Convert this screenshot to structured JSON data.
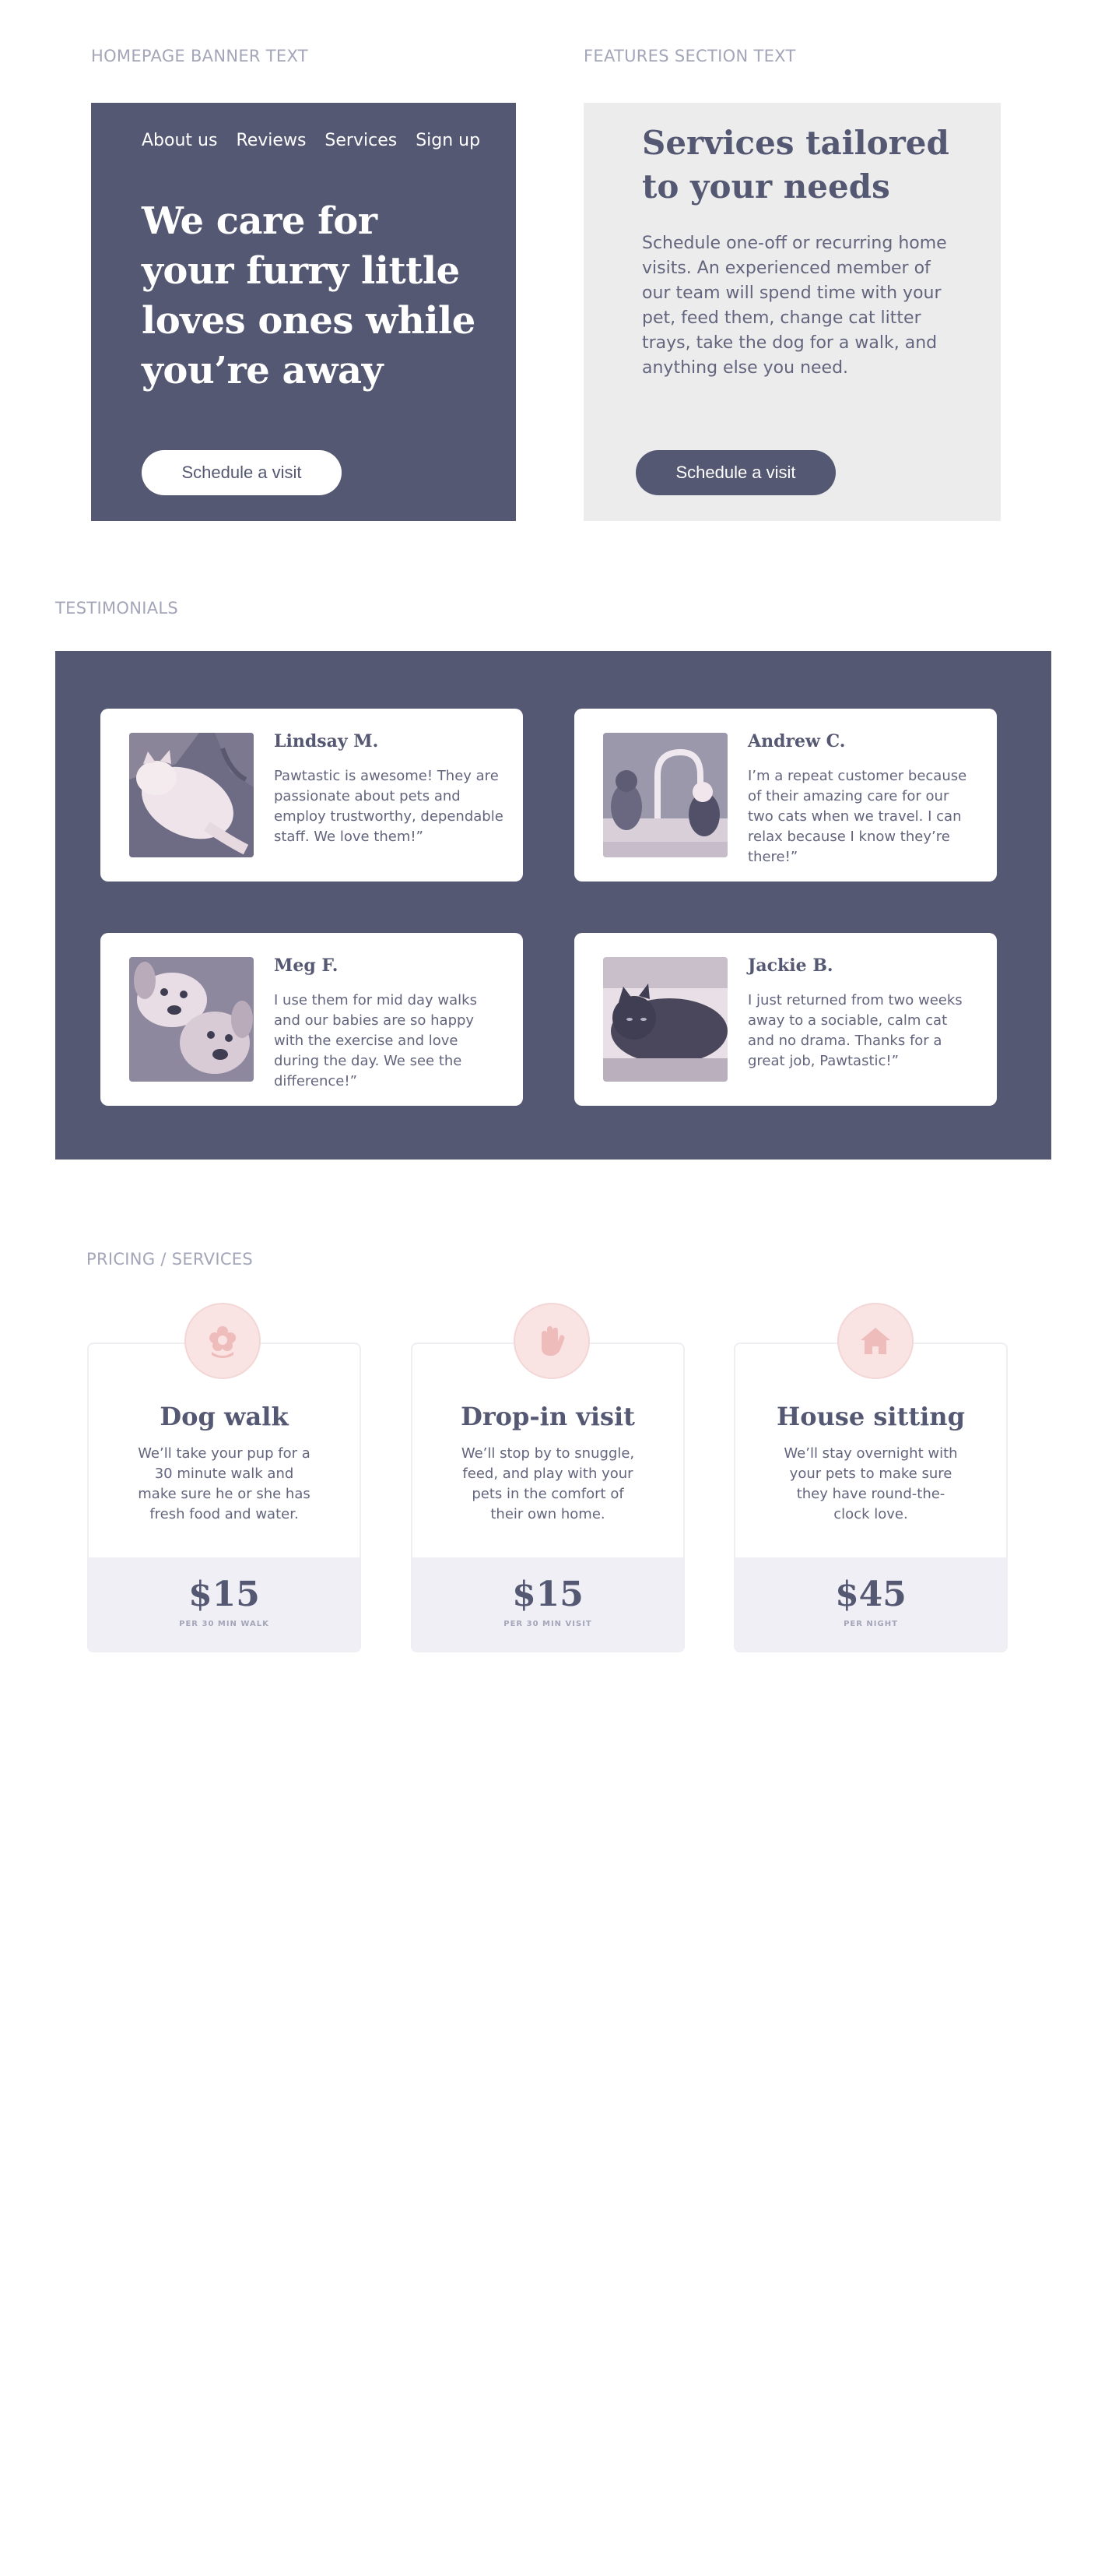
{
  "labels": {
    "banner": "HOMEPAGE BANNER TEXT",
    "features": "FEATURES SECTION TEXT",
    "testimonials": "TESTIMONIALS",
    "pricing": "PRICING / SERVICES"
  },
  "banner": {
    "nav": [
      "About us",
      "Reviews",
      "Services",
      "Sign up"
    ],
    "headline": "We care for your furry little loves ones while you’re away",
    "cta": "Schedule a visit"
  },
  "features": {
    "title": "Services tailored to your needs",
    "body": "Schedule one-off or recurring home visits. An experienced member of our team will spend time with your pet, feed them, change cat litter trays, take the dog for a walk, and anything else you need.",
    "cta": "Schedule a visit"
  },
  "testimonials": [
    {
      "name": "Lindsay M.",
      "text": "Pawtastic is awesome! They are passionate about pets and employ trustworthy, dependable staff. We love them!”",
      "photo": "sleeping-cat-photo"
    },
    {
      "name": "Andrew C.",
      "text": "I’m a repeat customer because of their amazing care for our two cats when we travel. I can relax because I know they’re there!”",
      "photo": "cats-at-faucet-photo"
    },
    {
      "name": "Meg F.",
      "text": "I use them for mid day walks and our babies are so happy with the exercise and love during the day. We see the difference!”",
      "photo": "two-puppies-photo"
    },
    {
      "name": "Jackie B.",
      "text": "I just returned from two weeks away to a sociable, calm cat and no drama. Thanks for a great job, Pawtastic!”",
      "photo": "black-cat-photo"
    }
  ],
  "pricing": [
    {
      "icon": "flower-icon",
      "title": "Dog walk",
      "desc": "We’ll take your pup for a 30 minute walk and make sure he or she has fresh food and water.",
      "price": "$15",
      "unit": "PER 30 MIN WALK"
    },
    {
      "icon": "hand-icon",
      "title": "Drop-in visit",
      "desc": "We’ll stop by to snuggle, feed, and play with your pets in the comfort of their own home.",
      "price": "$15",
      "unit": "PER 30 MIN VISIT"
    },
    {
      "icon": "house-icon",
      "title": "House sitting",
      "desc": "We’ll stay overnight with your pets to make sure they have round-the-clock love.",
      "price": "$45",
      "unit": "PER NIGHT"
    }
  ],
  "colors": {
    "primary": "#555872",
    "panel": "#ececec",
    "accent_pink": "#f9e3e3",
    "price_bg": "#efeff5"
  }
}
